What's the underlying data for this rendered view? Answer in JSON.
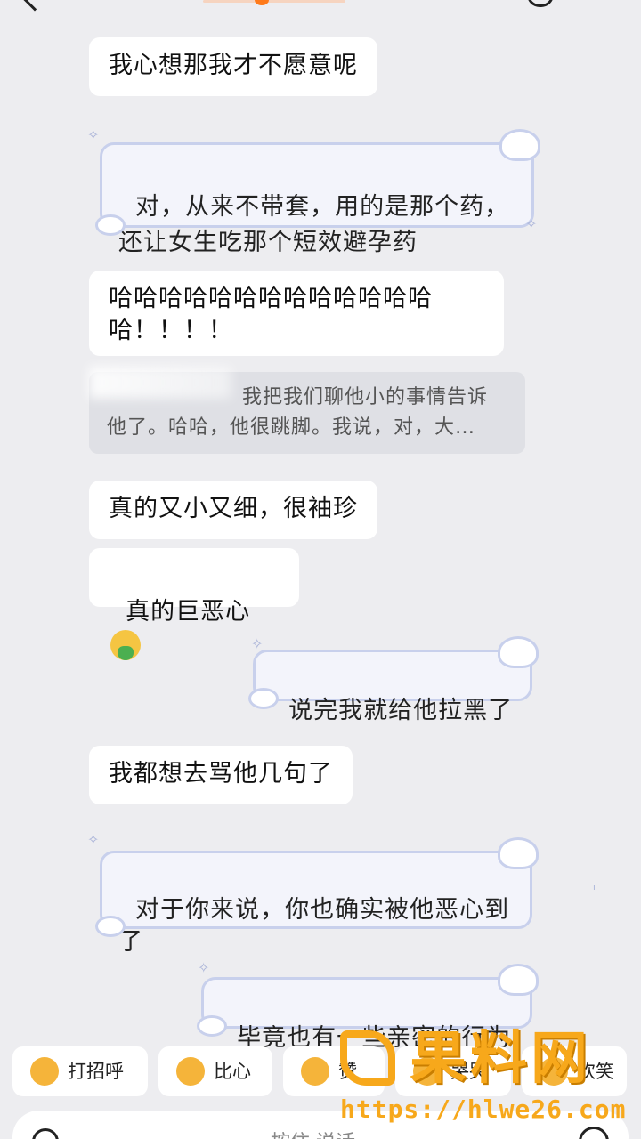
{
  "messages": [
    {
      "id": "m1",
      "side": "in",
      "text": "我心想那我才不愿意呢"
    },
    {
      "id": "m2",
      "side": "out",
      "text": "对，从来不带套，用的是那个药，\n还让女生吃那个短效避孕药"
    },
    {
      "id": "m3",
      "side": "in",
      "text": "哈哈哈哈哈哈哈哈哈哈哈哈哈\n哈！！！！"
    },
    {
      "id": "m4",
      "side": "in",
      "text": "真的又小又细，很袖珍"
    },
    {
      "id": "m5",
      "side": "in",
      "text": "真的巨恶心"
    },
    {
      "id": "m6",
      "side": "out",
      "text": "说完我就给他拉黑了"
    },
    {
      "id": "m7",
      "side": "in",
      "text": "我都想去骂他几句了"
    },
    {
      "id": "m8",
      "side": "out",
      "text": "对于你来说，你也确实被他恶心到\n了"
    },
    {
      "id": "m9",
      "side": "out",
      "text": "毕竟也有一些亲密的行为"
    }
  ],
  "quote": {
    "line1": "我把我们聊他小的事情告诉",
    "line2": "他了。哈哈，他很跳脚。我说，对，大…"
  },
  "quick_replies": [
    {
      "label": "打招呼",
      "icon": "wave-emoji-icon"
    },
    {
      "label": "比心",
      "icon": "heart-hands-emoji-icon"
    },
    {
      "label": "赞",
      "icon": "thumbs-up-emoji-icon"
    },
    {
      "label": "哭哭",
      "icon": "crying-emoji-icon"
    },
    {
      "label": "欢笑",
      "icon": "laughing-emoji-icon"
    }
  ],
  "input": {
    "placeholder": "按住 说话"
  },
  "watermark": {
    "title": "果料网",
    "url": "https://hlwe26.com"
  },
  "colors": {
    "background": "#ededf0",
    "incoming_bubble": "#ffffff",
    "outgoing_border": "#c8d0ec",
    "watermark": "#f7a81b"
  }
}
